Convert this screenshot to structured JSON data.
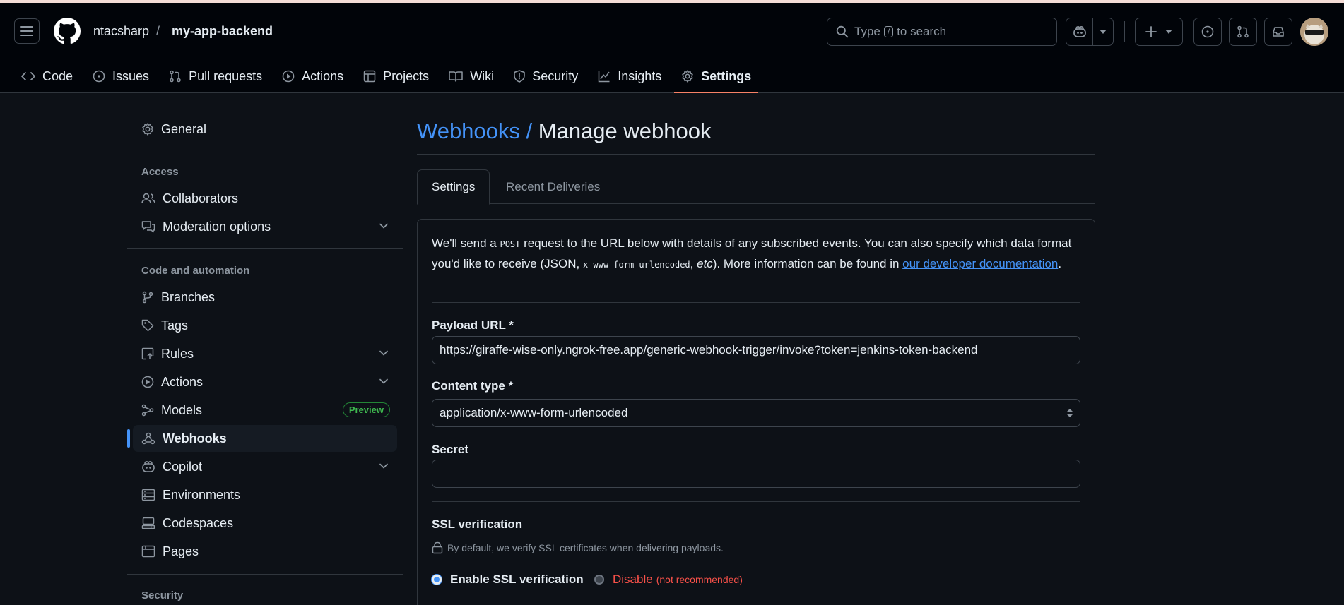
{
  "header": {
    "owner": "ntacsharp",
    "separator": "/",
    "repo": "my-app-backend",
    "search": {
      "pre": "Type",
      "key": "/",
      "post": "to search"
    }
  },
  "nav": [
    {
      "label": "Code",
      "icon": "code-icon"
    },
    {
      "label": "Issues",
      "icon": "issue-icon"
    },
    {
      "label": "Pull requests",
      "icon": "pull-request-icon"
    },
    {
      "label": "Actions",
      "icon": "play-icon"
    },
    {
      "label": "Projects",
      "icon": "table-icon"
    },
    {
      "label": "Wiki",
      "icon": "book-icon"
    },
    {
      "label": "Security",
      "icon": "shield-icon"
    },
    {
      "label": "Insights",
      "icon": "graph-icon"
    },
    {
      "label": "Settings",
      "icon": "gear-icon",
      "active": true
    }
  ],
  "sidebar": {
    "general": "General",
    "access_heading": "Access",
    "collaborators": "Collaborators",
    "moderation": "Moderation options",
    "code_heading": "Code and automation",
    "branches": "Branches",
    "tags": "Tags",
    "rules": "Rules",
    "actions": "Actions",
    "models": "Models",
    "models_badge": "Preview",
    "webhooks": "Webhooks",
    "copilot": "Copilot",
    "environments": "Environments",
    "codespaces": "Codespaces",
    "pages": "Pages",
    "security_heading": "Security"
  },
  "main": {
    "breadcrumb": "Webhooks /",
    "title": "Manage webhook",
    "tabs": [
      "Settings",
      "Recent Deliveries"
    ],
    "intro": {
      "p1": "We'll send a ",
      "post": "POST",
      "p2": " request to the URL below with details of any subscribed events. You can also specify which data format you'd like to receive (JSON, ",
      "form": "x-www-form-urlencoded",
      "p3": ", ",
      "etc": "etc",
      "p4": "). More information can be found in ",
      "link": "our developer documentation",
      "p5": "."
    },
    "payload_label": "Payload URL *",
    "payload_value": "https://giraffe-wise-only.ngrok-free.app/generic-webhook-trigger/invoke?token=jenkins-token-backend",
    "content_type_label": "Content type *",
    "content_type_value": "application/x-www-form-urlencoded",
    "secret_label": "Secret",
    "secret_value": "",
    "ssl_label": "SSL verification",
    "ssl_hint": "By default, we verify SSL certificates when delivering payloads.",
    "ssl_enable": "Enable SSL verification",
    "ssl_disable": "Disable",
    "ssl_disable_note": "(not recommended)"
  },
  "colors": {
    "accent": "#4493f8",
    "danger": "#f85149",
    "underline": "#f78166",
    "badge": "#3fb950"
  }
}
